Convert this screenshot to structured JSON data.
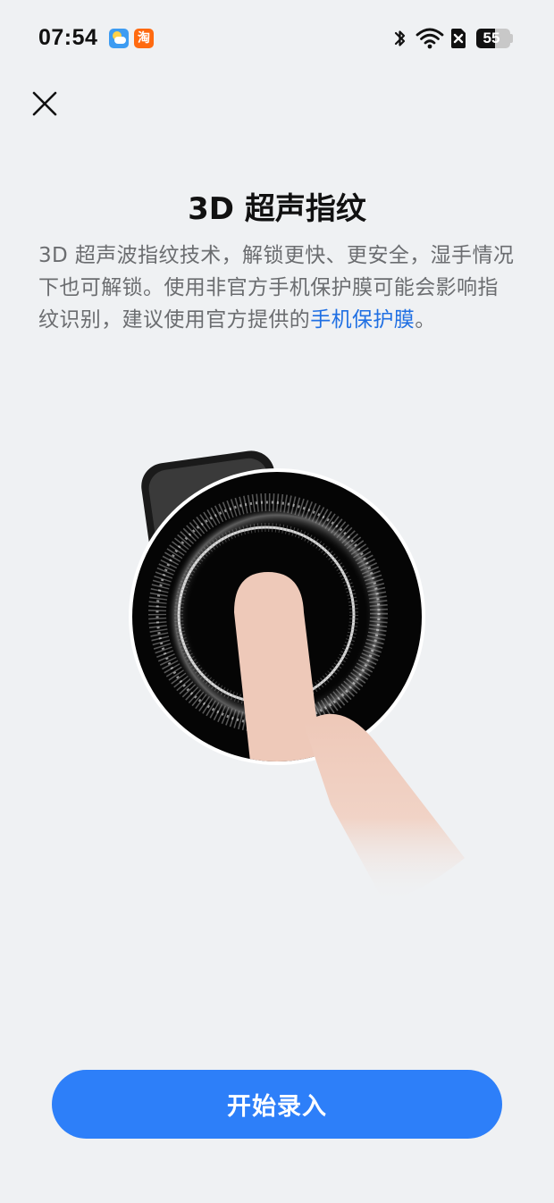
{
  "status_bar": {
    "time": "07:54",
    "notification_icons": [
      "weather-icon",
      "taobao-icon"
    ],
    "taobao_badge_text": "淘",
    "battery_level": "55",
    "icons": [
      "bluetooth-icon",
      "wifi-icon",
      "sim-disabled-icon",
      "battery-icon"
    ]
  },
  "header": {
    "close_icon": "close-icon"
  },
  "main": {
    "title": "3D 超声指纹",
    "description_text": "3D 超声波指纹技术，解锁更快、更安全，湿手情况下也可解锁。使用非官方手机保护膜可能会影响指纹识别，建议使用官方提供的",
    "description_link": "手机保护膜",
    "description_end": "。"
  },
  "footer": {
    "start_button_label": "开始录入"
  },
  "colors": {
    "background": "#eff1f3",
    "accent": "#2d7ff9",
    "link": "#1f6fe3"
  }
}
